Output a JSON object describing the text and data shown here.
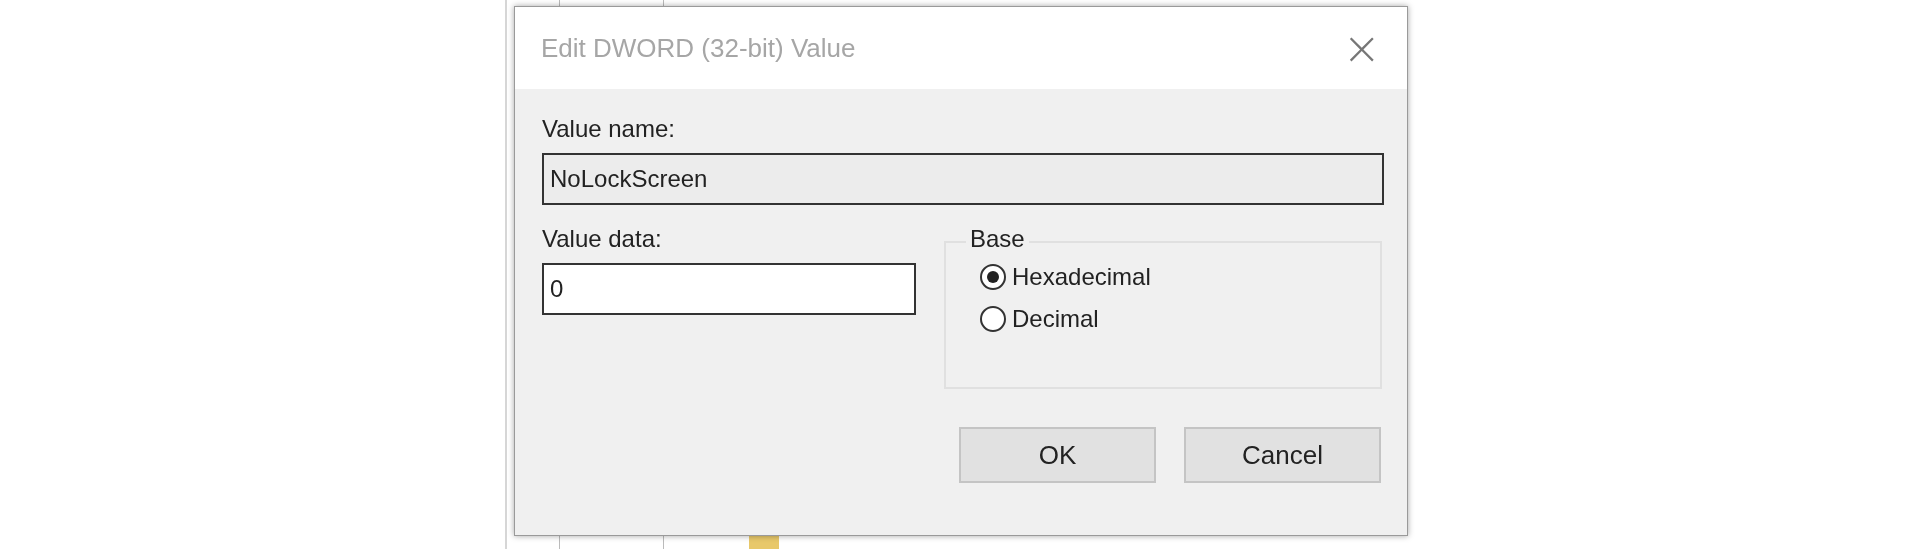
{
  "dialog": {
    "title": "Edit DWORD (32-bit) Value",
    "close": "×",
    "value_name": {
      "label": "Value name:",
      "value": "NoLockScreen"
    },
    "value_data": {
      "label": "Value data:",
      "value": "0"
    },
    "base": {
      "label": "Base",
      "options": [
        {
          "label": "Hexadecimal",
          "selected": true
        },
        {
          "label": "Decimal",
          "selected": false
        }
      ]
    },
    "buttons": [
      "OK",
      "Cancel"
    ]
  }
}
